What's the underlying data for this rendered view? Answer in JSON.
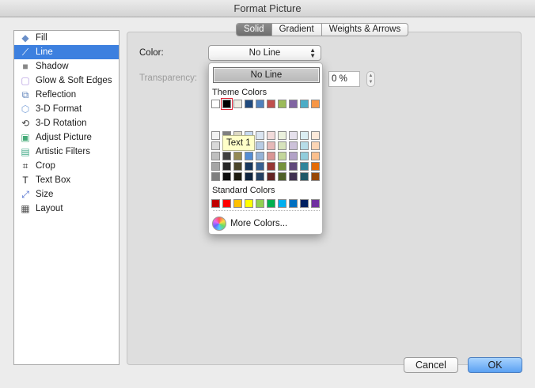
{
  "window": {
    "title": "Format Picture"
  },
  "sidebar": {
    "items": [
      {
        "label": "Fill",
        "icon": "paint-bucket-icon",
        "selected": false
      },
      {
        "label": "Line",
        "icon": "line-icon",
        "selected": true
      },
      {
        "label": "Shadow",
        "icon": "shadow-icon",
        "selected": false
      },
      {
        "label": "Glow & Soft Edges",
        "icon": "glow-icon",
        "selected": false
      },
      {
        "label": "Reflection",
        "icon": "reflection-icon",
        "selected": false
      },
      {
        "label": "3-D Format",
        "icon": "cube-icon",
        "selected": false
      },
      {
        "label": "3-D Rotation",
        "icon": "rotation-icon",
        "selected": false
      },
      {
        "label": "Adjust Picture",
        "icon": "adjust-picture-icon",
        "selected": false
      },
      {
        "label": "Artistic Filters",
        "icon": "artistic-filter-icon",
        "selected": false
      },
      {
        "label": "Crop",
        "icon": "crop-icon",
        "selected": false
      },
      {
        "label": "Text Box",
        "icon": "text-box-icon",
        "selected": false
      },
      {
        "label": "Size",
        "icon": "size-icon",
        "selected": false
      },
      {
        "label": "Layout",
        "icon": "layout-icon",
        "selected": false
      }
    ]
  },
  "tabs": [
    {
      "label": "Solid",
      "active": true
    },
    {
      "label": "Gradient",
      "active": false
    },
    {
      "label": "Weights & Arrows",
      "active": false
    }
  ],
  "form": {
    "color_label": "Color:",
    "color_value": "No Line",
    "transparency_label": "Transparency:",
    "transparency_value": "0 %"
  },
  "dropdown": {
    "no_line_label": "No Line",
    "theme_colors_label": "Theme Colors",
    "theme_top_row": [
      "#ffffff",
      "#000000",
      "#eeece1",
      "#1f497d",
      "#4f81bd",
      "#c0504d",
      "#9bbb59",
      "#8064a2",
      "#4bacc6",
      "#f79646"
    ],
    "theme_shades": [
      [
        "#f2f2f2",
        "#d9d9d9",
        "#bfbfbf",
        "#a6a6a6",
        "#808080"
      ],
      [
        "#808080",
        "#595959",
        "#404040",
        "#262626",
        "#0d0d0d"
      ],
      [
        "#ddd9c4",
        "#c4bd97",
        "#948a54",
        "#4a452a",
        "#1e1c11"
      ],
      [
        "#c6d9f0",
        "#8db3e2",
        "#548dd4",
        "#17375e",
        "#0f243e"
      ],
      [
        "#dbe5f1",
        "#b8cce4",
        "#95b3d7",
        "#376092",
        "#244062"
      ],
      [
        "#f2dcdb",
        "#e6b9b8",
        "#d99694",
        "#953734",
        "#632423"
      ],
      [
        "#ebf1dd",
        "#d7e3bc",
        "#c3d69b",
        "#76923c",
        "#4f6128"
      ],
      [
        "#e5e0ec",
        "#ccc1d9",
        "#b2a2c7",
        "#5f497a",
        "#3f3151"
      ],
      [
        "#dbeef3",
        "#b7dde8",
        "#92cddc",
        "#31859b",
        "#205867"
      ],
      [
        "#fdeada",
        "#fbd5b5",
        "#fac08f",
        "#e36c09",
        "#974806"
      ]
    ],
    "selected_theme_color_tooltip": "Text 1",
    "standard_colors_label": "Standard Colors",
    "standard_colors": [
      "#c00000",
      "#ff0000",
      "#ffc000",
      "#ffff00",
      "#92d050",
      "#00b050",
      "#00b0f0",
      "#0070c0",
      "#002060",
      "#7030a0"
    ],
    "more_colors_label": "More Colors..."
  },
  "buttons": {
    "cancel": "Cancel",
    "ok": "OK"
  }
}
